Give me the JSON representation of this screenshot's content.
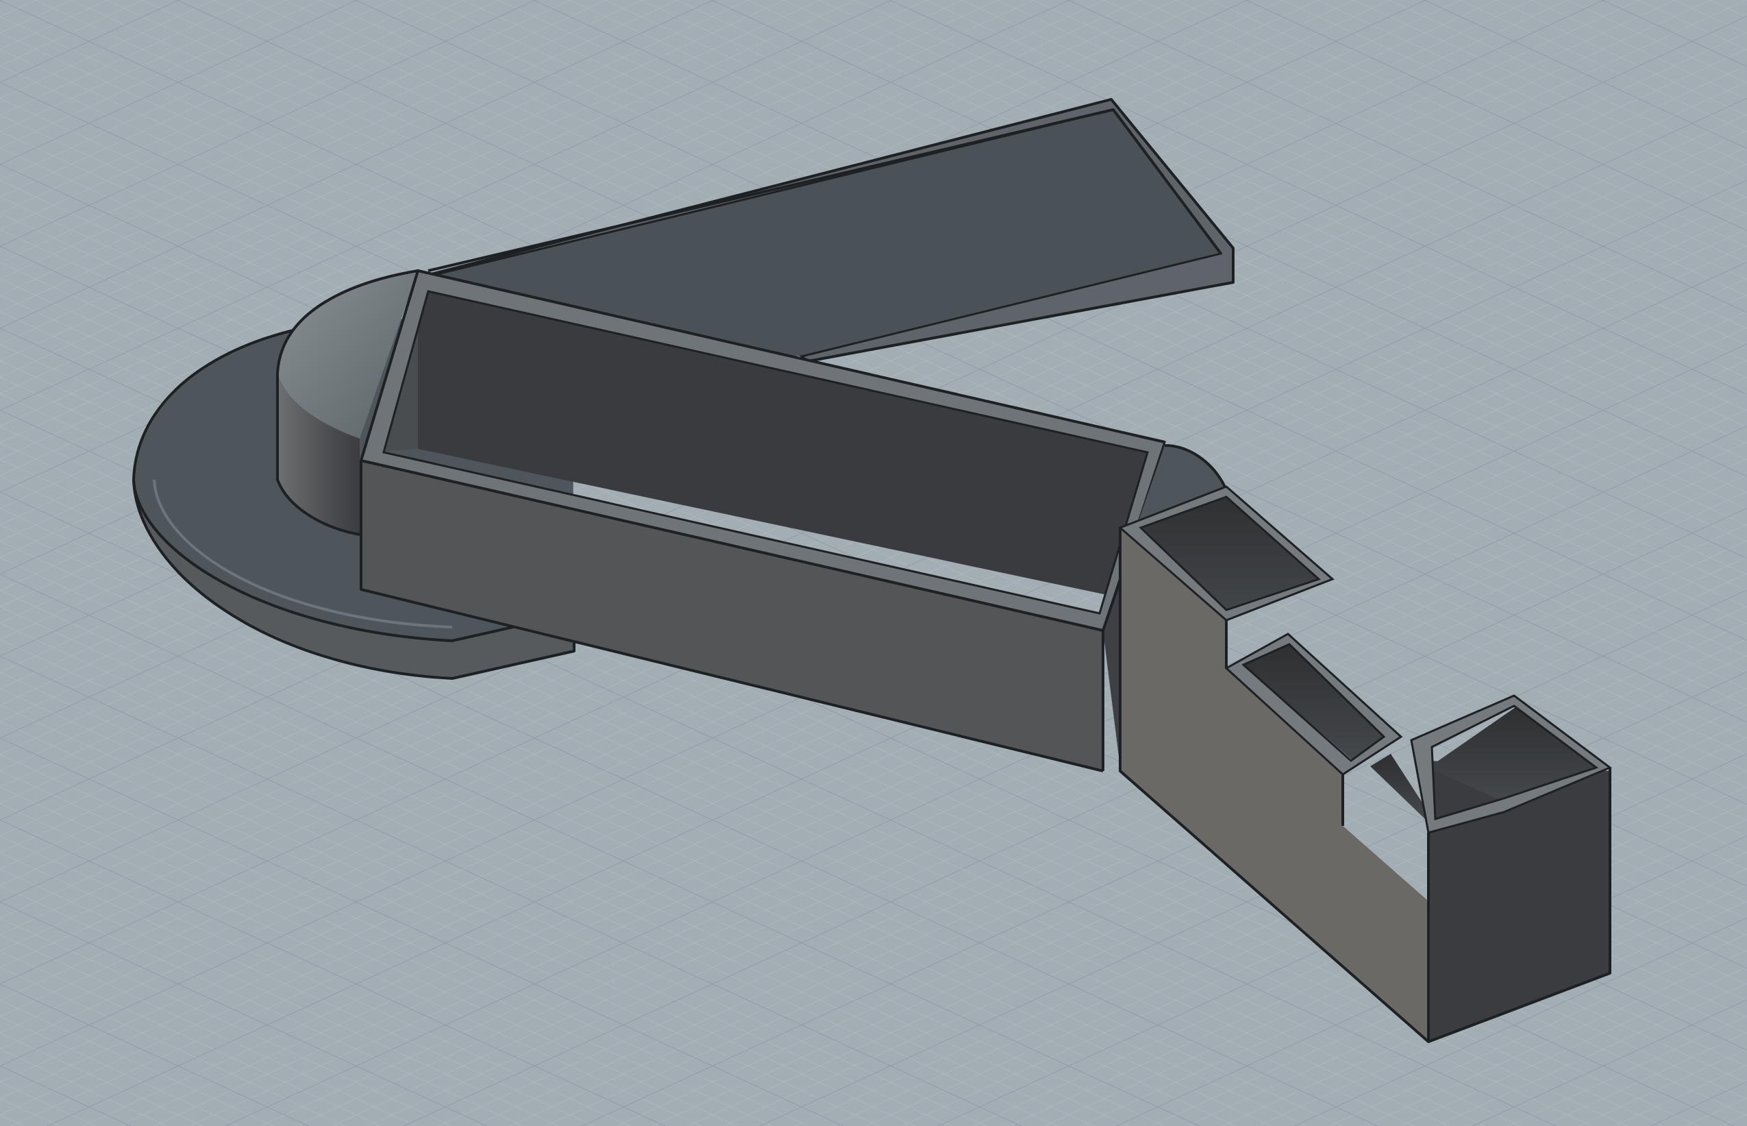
{
  "viewport": {
    "background_color": "#a3adb4",
    "grid_minor_color": "#b2bcc3",
    "grid_major_color": "#8f99a1",
    "model_colors": {
      "light_face": "#6f6e6c",
      "mid_face": "#555657",
      "dark_face": "#3d3f42",
      "floor_face": "#4b5257",
      "top_face": "#5d666d",
      "rim": "#7a7f83",
      "edge": "#1e2124"
    }
  }
}
